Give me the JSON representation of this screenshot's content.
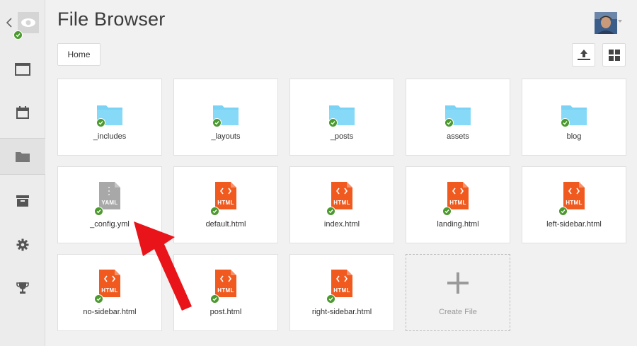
{
  "app": {
    "title": "File Browser"
  },
  "breadcrumb": {
    "home": "Home"
  },
  "sidebar": {
    "items": [
      {
        "name": "window"
      },
      {
        "name": "calendar"
      },
      {
        "name": "folder"
      },
      {
        "name": "archive"
      },
      {
        "name": "settings"
      },
      {
        "name": "trophy"
      }
    ]
  },
  "files": [
    {
      "label": "_includes",
      "type": "folder",
      "synced": true
    },
    {
      "label": "_layouts",
      "type": "folder",
      "synced": true
    },
    {
      "label": "_posts",
      "type": "folder",
      "synced": true
    },
    {
      "label": "assets",
      "type": "folder",
      "synced": true
    },
    {
      "label": "blog",
      "type": "folder",
      "synced": true
    },
    {
      "label": "_config.yml",
      "type": "yaml",
      "badge": "YAML",
      "synced": true
    },
    {
      "label": "default.html",
      "type": "html",
      "badge": "HTML",
      "synced": true
    },
    {
      "label": "index.html",
      "type": "html",
      "badge": "HTML",
      "synced": true
    },
    {
      "label": "landing.html",
      "type": "html",
      "badge": "HTML",
      "synced": true
    },
    {
      "label": "left-sidebar.html",
      "type": "html",
      "badge": "HTML",
      "synced": true
    },
    {
      "label": "no-sidebar.html",
      "type": "html",
      "badge": "HTML",
      "synced": true
    },
    {
      "label": "post.html",
      "type": "html",
      "badge": "HTML",
      "synced": true
    },
    {
      "label": "right-sidebar.html",
      "type": "html",
      "badge": "HTML",
      "synced": true
    }
  ],
  "create_file": {
    "label": "Create File"
  },
  "colors": {
    "folder": "#7ad3f5",
    "html": "#f15a1f",
    "yaml": "#a8a8a8",
    "sync": "#4b9a2e",
    "arrow": "#e8141a"
  }
}
